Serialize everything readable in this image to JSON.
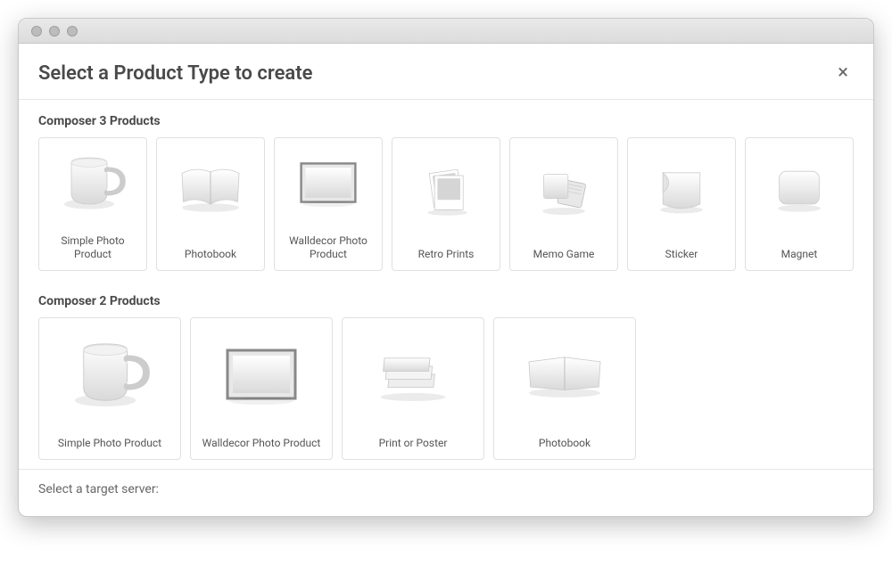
{
  "window": {
    "title": "Select a Product Type to create"
  },
  "sections": [
    {
      "title": "Composer 3 Products",
      "cards": [
        {
          "id": "simple-photo-product",
          "label": "Simple Photo Product",
          "icon": "mug"
        },
        {
          "id": "photobook",
          "label": "Photobook",
          "icon": "book-open"
        },
        {
          "id": "walldecor",
          "label": "Walldecor Photo Product",
          "icon": "canvas"
        },
        {
          "id": "retro-prints",
          "label": "Retro Prints",
          "icon": "polaroids"
        },
        {
          "id": "memo-game",
          "label": "Memo Game",
          "icon": "tiles"
        },
        {
          "id": "sticker",
          "label": "Sticker",
          "icon": "peel"
        },
        {
          "id": "magnet",
          "label": "Magnet",
          "icon": "rounded-rect"
        }
      ]
    },
    {
      "title": "Composer 2 Products",
      "cards": [
        {
          "id": "simple-photo-product-2",
          "label": "Simple Photo Product",
          "icon": "mug"
        },
        {
          "id": "walldecor-2",
          "label": "Walldecor Photo Product",
          "icon": "canvas"
        },
        {
          "id": "print-poster",
          "label": "Print or Poster",
          "icon": "stack"
        },
        {
          "id": "photobook-2",
          "label": "Photobook",
          "icon": "book-open-flat"
        }
      ]
    }
  ],
  "targetServerLabel": "Select a target server:"
}
